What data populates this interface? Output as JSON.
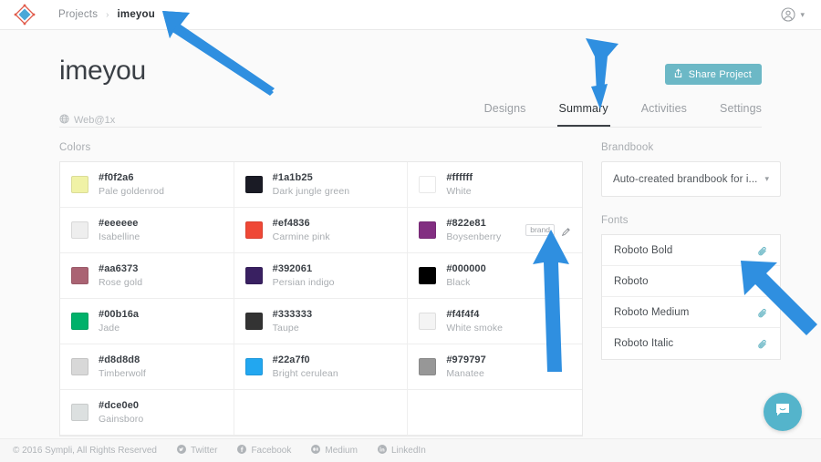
{
  "topbar": {
    "logo_icon": "sympli-diamond-logo",
    "breadcrumb": {
      "root": "Projects",
      "separator": "›",
      "current": "imeyou"
    },
    "avatar_icon": "user-circle-icon",
    "chevron_icon": "chevron-down-icon"
  },
  "header": {
    "project_title": "imeyou",
    "platform_icon": "globe-icon",
    "platform": "Web@1x",
    "share_button": {
      "label": "Share Project",
      "icon": "share-upload-icon",
      "color": "#6cb8c6"
    },
    "tabs": [
      {
        "label": "Designs",
        "active": false
      },
      {
        "label": "Summary",
        "active": true
      },
      {
        "label": "Activities",
        "active": false
      },
      {
        "label": "Settings",
        "active": false
      }
    ]
  },
  "colors_section": {
    "label": "Colors",
    "swatches": [
      {
        "hex": "#f0f2a6",
        "name": "Pale goldenrod"
      },
      {
        "hex": "#1a1b25",
        "name": "Dark jungle green"
      },
      {
        "hex": "#ffffff",
        "name": "White"
      },
      {
        "hex": "#eeeeee",
        "name": "Isabelline"
      },
      {
        "hex": "#ef4836",
        "name": "Carmine pink"
      },
      {
        "hex": "#822e81",
        "name": "Boysenberry",
        "tag": "brand",
        "edit_icon": "pencil-icon"
      },
      {
        "hex": "#aa6373",
        "name": "Rose gold"
      },
      {
        "hex": "#392061",
        "name": "Persian indigo"
      },
      {
        "hex": "#000000",
        "name": "Black"
      },
      {
        "hex": "#00b16a",
        "name": "Jade"
      },
      {
        "hex": "#333333",
        "name": "Taupe"
      },
      {
        "hex": "#f4f4f4",
        "name": "White smoke"
      },
      {
        "hex": "#d8d8d8",
        "name": "Timberwolf"
      },
      {
        "hex": "#22a7f0",
        "name": "Bright cerulean"
      },
      {
        "hex": "#979797",
        "name": "Manatee"
      },
      {
        "hex": "#dce0e0",
        "name": "Gainsboro"
      }
    ]
  },
  "brandbook_section": {
    "label": "Brandbook",
    "selected": "Auto-created brandbook for i...",
    "chevron_icon": "chevron-down-icon"
  },
  "fonts_section": {
    "label": "Fonts",
    "fonts": [
      {
        "name": "Roboto Bold",
        "icon": "paperclip-icon"
      },
      {
        "name": "Roboto",
        "icon": "paperclip-icon"
      },
      {
        "name": "Roboto Medium",
        "icon": "paperclip-icon"
      },
      {
        "name": "Roboto Italic",
        "icon": "paperclip-icon"
      }
    ]
  },
  "footer": {
    "copyright": "© 2016 Sympli, All Rights Reserved",
    "links": [
      {
        "label": "Twitter",
        "icon": "twitter-icon"
      },
      {
        "label": "Facebook",
        "icon": "facebook-icon"
      },
      {
        "label": "Medium",
        "icon": "medium-icon"
      },
      {
        "label": "LinkedIn",
        "icon": "linkedin-icon"
      }
    ]
  },
  "chat_widget": {
    "icon": "chat-bubble-icon",
    "color": "#54b4cb"
  },
  "annotations": {
    "arrow_color": "#2f8fe0",
    "arrows": [
      {
        "id": "arrow-breadcrumb",
        "points_to": "breadcrumb-current"
      },
      {
        "id": "arrow-summary",
        "points_to": "tab-summary"
      },
      {
        "id": "arrow-brand",
        "points_to": "brand-tag"
      },
      {
        "id": "arrow-font",
        "points_to": "font-attach-icon"
      }
    ]
  }
}
